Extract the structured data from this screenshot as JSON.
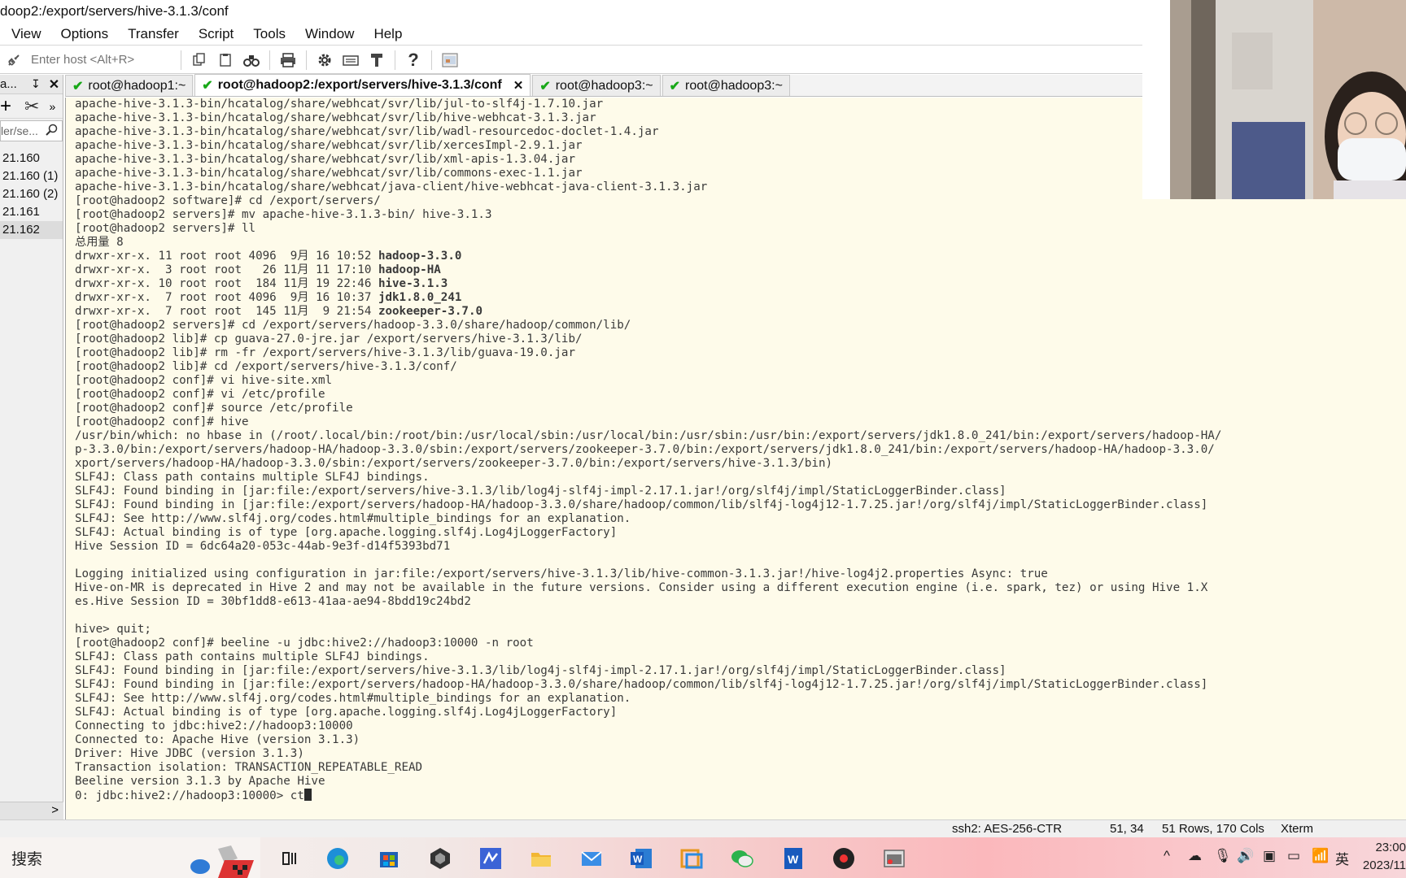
{
  "window": {
    "title": "doop2:/export/servers/hive-3.1.3/conf"
  },
  "menu": [
    "View",
    "Options",
    "Transfer",
    "Script",
    "Tools",
    "Window",
    "Help"
  ],
  "toolbar": {
    "host_placeholder": "Enter host <Alt+R>"
  },
  "left_panel": {
    "title": "a...",
    "filter_placeholder": "ler/se...",
    "sessions": [
      "21.160",
      "21.160 (1)",
      "21.160 (2)",
      "21.161",
      "21.162"
    ]
  },
  "tabs": [
    {
      "label": "root@hadoop1:~",
      "active": false
    },
    {
      "label": "root@hadoop2:/export/servers/hive-3.1.3/conf",
      "active": true
    },
    {
      "label": "root@hadoop3:~",
      "active": false
    },
    {
      "label": "root@hadoop3:~",
      "active": false
    }
  ],
  "terminal": {
    "lines": [
      "apache-hive-3.1.3-bin/hcatalog/share/webhcat/svr/lib/jul-to-slf4j-1.7.10.jar",
      "apache-hive-3.1.3-bin/hcatalog/share/webhcat/svr/lib/hive-webhcat-3.1.3.jar",
      "apache-hive-3.1.3-bin/hcatalog/share/webhcat/svr/lib/wadl-resourcedoc-doclet-1.4.jar",
      "apache-hive-3.1.3-bin/hcatalog/share/webhcat/svr/lib/xercesImpl-2.9.1.jar",
      "apache-hive-3.1.3-bin/hcatalog/share/webhcat/svr/lib/xml-apis-1.3.04.jar",
      "apache-hive-3.1.3-bin/hcatalog/share/webhcat/svr/lib/commons-exec-1.1.jar",
      "apache-hive-3.1.3-bin/hcatalog/share/webhcat/java-client/hive-webhcat-java-client-3.1.3.jar",
      "[root@hadoop2 software]# cd /export/servers/",
      "[root@hadoop2 servers]# mv apache-hive-3.1.3-bin/ hive-3.1.3",
      "[root@hadoop2 servers]# ll",
      "总用量 8"
    ],
    "ll_rows": [
      {
        "meta": "drwxr-xr-x. 11 root root 4096  9月 16 10:52 ",
        "name": "hadoop-3.3.0"
      },
      {
        "meta": "drwxr-xr-x.  3 root root   26 11月 11 17:10 ",
        "name": "hadoop-HA"
      },
      {
        "meta": "drwxr-xr-x. 10 root root  184 11月 19 22:46 ",
        "name": "hive-3.1.3"
      },
      {
        "meta": "drwxr-xr-x.  7 root root 4096  9月 16 10:37 ",
        "name": "jdk1.8.0_241"
      },
      {
        "meta": "drwxr-xr-x.  7 root root  145 11月  9 21:54 ",
        "name": "zookeeper-3.7.0"
      }
    ],
    "lines_after": [
      "[root@hadoop2 servers]# cd /export/servers/hadoop-3.3.0/share/hadoop/common/lib/",
      "[root@hadoop2 lib]# cp guava-27.0-jre.jar /export/servers/hive-3.1.3/lib/",
      "[root@hadoop2 lib]# rm -fr /export/servers/hive-3.1.3/lib/guava-19.0.jar",
      "[root@hadoop2 lib]# cd /export/servers/hive-3.1.3/conf/",
      "[root@hadoop2 conf]# vi hive-site.xml",
      "[root@hadoop2 conf]# vi /etc/profile",
      "[root@hadoop2 conf]# source /etc/profile",
      "[root@hadoop2 conf]# hive",
      "/usr/bin/which: no hbase in (/root/.local/bin:/root/bin:/usr/local/sbin:/usr/local/bin:/usr/sbin:/usr/bin:/export/servers/jdk1.8.0_241/bin:/export/servers/hadoop-HA/",
      "p-3.3.0/bin:/export/servers/hadoop-HA/hadoop-3.3.0/sbin:/export/servers/zookeeper-3.7.0/bin:/export/servers/jdk1.8.0_241/bin:/export/servers/hadoop-HA/hadoop-3.3.0/",
      "xport/servers/hadoop-HA/hadoop-3.3.0/sbin:/export/servers/zookeeper-3.7.0/bin:/export/servers/hive-3.1.3/bin)",
      "SLF4J: Class path contains multiple SLF4J bindings.",
      "SLF4J: Found binding in [jar:file:/export/servers/hive-3.1.3/lib/log4j-slf4j-impl-2.17.1.jar!/org/slf4j/impl/StaticLoggerBinder.class]",
      "SLF4J: Found binding in [jar:file:/export/servers/hadoop-HA/hadoop-3.3.0/share/hadoop/common/lib/slf4j-log4j12-1.7.25.jar!/org/slf4j/impl/StaticLoggerBinder.class]",
      "SLF4J: See http://www.slf4j.org/codes.html#multiple_bindings for an explanation.",
      "SLF4J: Actual binding is of type [org.apache.logging.slf4j.Log4jLoggerFactory]",
      "Hive Session ID = 6dc64a20-053c-44ab-9e3f-d14f5393bd71",
      "",
      "Logging initialized using configuration in jar:file:/export/servers/hive-3.1.3/lib/hive-common-3.1.3.jar!/hive-log4j2.properties Async: true",
      "Hive-on-MR is deprecated in Hive 2 and may not be available in the future versions. Consider using a different execution engine (i.e. spark, tez) or using Hive 1.X",
      "es.Hive Session ID = 30bf1dd8-e613-41aa-ae94-8bdd19c24bd2",
      "",
      "hive> quit;",
      "[root@hadoop2 conf]# beeline -u jdbc:hive2://hadoop3:10000 -n root",
      "SLF4J: Class path contains multiple SLF4J bindings.",
      "SLF4J: Found binding in [jar:file:/export/servers/hive-3.1.3/lib/log4j-slf4j-impl-2.17.1.jar!/org/slf4j/impl/StaticLoggerBinder.class]",
      "SLF4J: Found binding in [jar:file:/export/servers/hadoop-HA/hadoop-3.3.0/share/hadoop/common/lib/slf4j-log4j12-1.7.25.jar!/org/slf4j/impl/StaticLoggerBinder.class]",
      "SLF4J: See http://www.slf4j.org/codes.html#multiple_bindings for an explanation.",
      "SLF4J: Actual binding is of type [org.apache.logging.slf4j.Log4jLoggerFactory]",
      "Connecting to jdbc:hive2://hadoop3:10000",
      "Connected to: Apache Hive (version 3.1.3)",
      "Driver: Hive JDBC (version 3.1.3)",
      "Transaction isolation: TRANSACTION_REPEATABLE_READ",
      "Beeline version 3.1.3 by Apache Hive"
    ],
    "prompt_line": "0: jdbc:hive2://hadoop3:10000> ct"
  },
  "statusbar": {
    "cipher": "ssh2: AES-256-CTR",
    "cursor_pos": "51,  34",
    "size": "51 Rows, 170 Cols",
    "term_type": "Xterm"
  },
  "taskbar": {
    "search_label": "搜索",
    "ime": "英",
    "time": "23:00",
    "date": "2023/11"
  },
  "colors": {
    "terminal_bg": "#fefbea",
    "terminal_fg": "#3a3a3a",
    "tab_check": "#18a818"
  }
}
